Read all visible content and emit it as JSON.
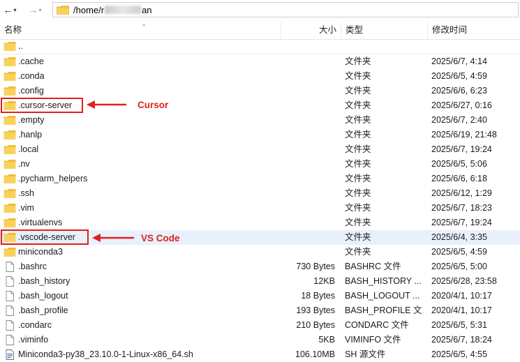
{
  "address": {
    "path_prefix": "/home/r",
    "path_suffix": "an"
  },
  "columns": {
    "name": "名称",
    "size": "大小",
    "type": "类型",
    "modified": "修改时间"
  },
  "parent": {
    "name": ".."
  },
  "rows": [
    {
      "name": ".cache",
      "size": "",
      "type": "文件夹",
      "modified": "2025/6/7, 4:14",
      "kind": "folder"
    },
    {
      "name": ".conda",
      "size": "",
      "type": "文件夹",
      "modified": "2025/6/5, 4:59",
      "kind": "folder"
    },
    {
      "name": ".config",
      "size": "",
      "type": "文件夹",
      "modified": "2025/6/6, 6:23",
      "kind": "folder"
    },
    {
      "name": ".cursor-server",
      "size": "",
      "type": "文件夹",
      "modified": "2025/6/27, 0:16",
      "kind": "folder"
    },
    {
      "name": ".empty",
      "size": "",
      "type": "文件夹",
      "modified": "2025/6/7, 2:40",
      "kind": "folder"
    },
    {
      "name": ".hanlp",
      "size": "",
      "type": "文件夹",
      "modified": "2025/6/19, 21:48",
      "kind": "folder"
    },
    {
      "name": ".local",
      "size": "",
      "type": "文件夹",
      "modified": "2025/6/7, 19:24",
      "kind": "folder"
    },
    {
      "name": ".nv",
      "size": "",
      "type": "文件夹",
      "modified": "2025/6/5, 5:06",
      "kind": "folder"
    },
    {
      "name": ".pycharm_helpers",
      "size": "",
      "type": "文件夹",
      "modified": "2025/6/6, 6:18",
      "kind": "folder"
    },
    {
      "name": ".ssh",
      "size": "",
      "type": "文件夹",
      "modified": "2025/6/12, 1:29",
      "kind": "folder"
    },
    {
      "name": ".vim",
      "size": "",
      "type": "文件夹",
      "modified": "2025/6/7, 18:23",
      "kind": "folder"
    },
    {
      "name": ".virtualenvs",
      "size": "",
      "type": "文件夹",
      "modified": "2025/6/7, 19:24",
      "kind": "folder"
    },
    {
      "name": ".vscode-server",
      "size": "",
      "type": "文件夹",
      "modified": "2025/6/4, 3:35",
      "kind": "folder"
    },
    {
      "name": "miniconda3",
      "size": "",
      "type": "文件夹",
      "modified": "2025/6/5, 4:59",
      "kind": "folder"
    },
    {
      "name": ".bashrc",
      "size": "730 Bytes",
      "type": "BASHRC 文件",
      "modified": "2025/6/5, 5:00",
      "kind": "file"
    },
    {
      "name": ".bash_history",
      "size": "12KB",
      "type": "BASH_HISTORY ...",
      "modified": "2025/6/28, 23:58",
      "kind": "file"
    },
    {
      "name": ".bash_logout",
      "size": "18 Bytes",
      "type": "BASH_LOGOUT ...",
      "modified": "2020/4/1, 10:17",
      "kind": "file"
    },
    {
      "name": ".bash_profile",
      "size": "193 Bytes",
      "type": "BASH_PROFILE 文...",
      "modified": "2020/4/1, 10:17",
      "kind": "file"
    },
    {
      "name": ".condarc",
      "size": "210 Bytes",
      "type": "CONDARC 文件",
      "modified": "2025/6/5, 5:31",
      "kind": "file"
    },
    {
      "name": ".viminfo",
      "size": "5KB",
      "type": "VIMINFO 文件",
      "modified": "2025/6/7, 18:24",
      "kind": "file"
    },
    {
      "name": "Miniconda3-py38_23.10.0-1-Linux-x86_64.sh",
      "size": "106.10MB",
      "type": "SH 源文件",
      "modified": "2025/6/5, 4:55",
      "kind": "script"
    }
  ],
  "annotations": {
    "cursor_label": "Cursor",
    "vscode_label": "VS Code"
  },
  "colors": {
    "accent_red": "#e0201b",
    "folder_yellow": "#f5c542",
    "selected_row": "#e8f1fb"
  }
}
